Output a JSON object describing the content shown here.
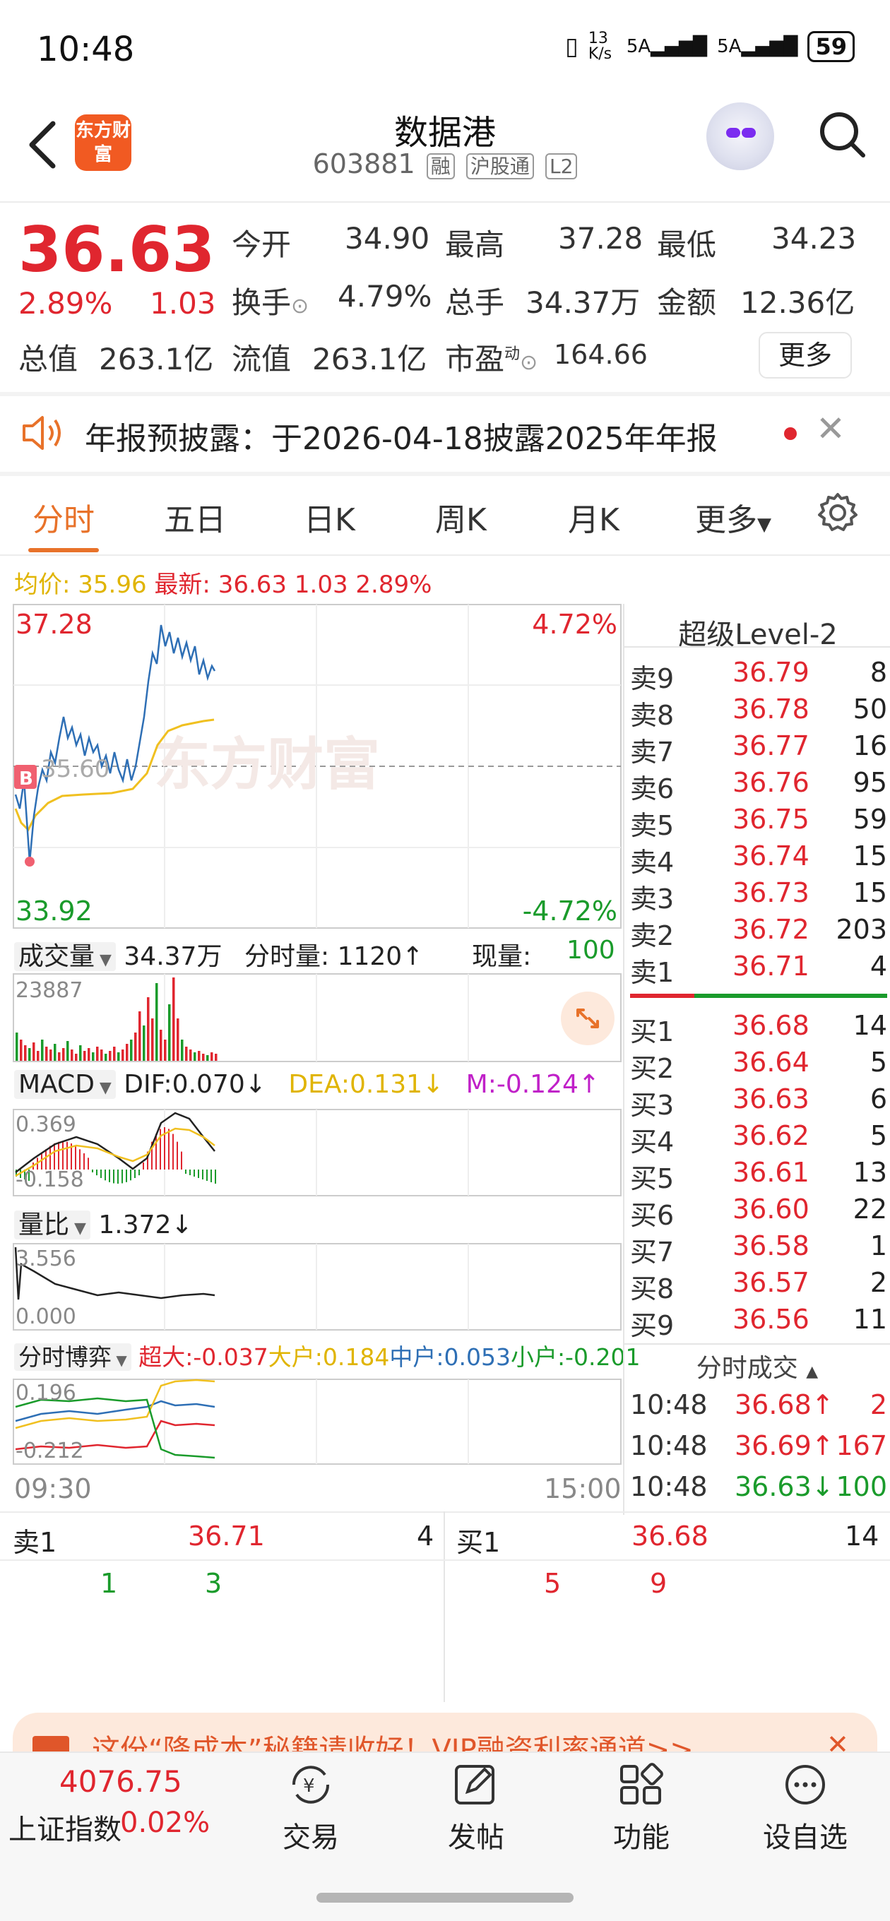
{
  "status_bar": {
    "time": "10:48",
    "net_speed": "13 K/s",
    "signal1": "5A",
    "signal2": "5A",
    "battery": "59"
  },
  "header": {
    "title": "数据港",
    "code": "603881",
    "tags": [
      "融",
      "沪股通",
      "L2"
    ],
    "logo_text": "东方财富"
  },
  "quote": {
    "price": "36.63",
    "pct": "2.89%",
    "change": "1.03",
    "open_label": "今开",
    "open": "34.90",
    "high_label": "最高",
    "high": "37.28",
    "low_label": "最低",
    "low": "34.23",
    "turnover_label": "换手",
    "turnover": "4.79%",
    "volume_label": "总手",
    "volume": "34.37万",
    "amount_label": "金额",
    "amount": "12.36亿",
    "mktcap_label": "总值",
    "mktcap": "263.1亿",
    "float_label": "流值",
    "float": "263.1亿",
    "pe_label": "市盈",
    "pe_sup": "动",
    "pe": "164.66",
    "more": "更多"
  },
  "notice": {
    "text": "年报预披露：于2026-04-18披露2025年年报"
  },
  "tabs": [
    "分时",
    "五日",
    "日K",
    "周K",
    "月K",
    "更多"
  ],
  "chart_info": {
    "avg_label": "均价:",
    "avg": "35.96",
    "latest_label": "最新:",
    "latest": "36.63",
    "chg": "1.03",
    "pct": "2.89%"
  },
  "main_chart": {
    "top_price": "37.28",
    "bottom_price": "33.92",
    "top_pct": "4.72%",
    "bottom_pct": "-4.72%",
    "mid": "35.60",
    "watermark": "东方财富",
    "b_marker": "B"
  },
  "volume": {
    "label": "成交量",
    "total": "34.37万",
    "fen_label": "分时量:",
    "fen": "1120↑",
    "now_label": "现量:",
    "now": "100",
    "max": "23887"
  },
  "macd": {
    "label": "MACD",
    "dif": "DIF:0.070↓",
    "dea": "DEA:0.131↓",
    "m": "M:-0.124↑",
    "top": "0.369",
    "bottom": "-0.158"
  },
  "ratio": {
    "label": "量比",
    "value": "1.372↓",
    "top": "3.556",
    "bottom": "0.000"
  },
  "game": {
    "label": "分时博弈",
    "big": "超大:-0.037",
    "large": "大户:0.184",
    "mid": "中户:0.053",
    "small": "小户:-0.201",
    "top": "0.196",
    "bottom": "-0.212"
  },
  "time_axis": {
    "start": "09:30",
    "end": "15:00"
  },
  "level2": {
    "title": "超级Level-2",
    "asks": [
      {
        "label": "卖9",
        "price": "36.79",
        "vol": "8"
      },
      {
        "label": "卖8",
        "price": "36.78",
        "vol": "50"
      },
      {
        "label": "卖7",
        "price": "36.77",
        "vol": "16"
      },
      {
        "label": "卖6",
        "price": "36.76",
        "vol": "95"
      },
      {
        "label": "卖5",
        "price": "36.75",
        "vol": "59"
      },
      {
        "label": "卖4",
        "price": "36.74",
        "vol": "15"
      },
      {
        "label": "卖3",
        "price": "36.73",
        "vol": "15"
      },
      {
        "label": "卖2",
        "price": "36.72",
        "vol": "203"
      },
      {
        "label": "卖1",
        "price": "36.71",
        "vol": "4"
      }
    ],
    "bids": [
      {
        "label": "买1",
        "price": "36.68",
        "vol": "14"
      },
      {
        "label": "买2",
        "price": "36.64",
        "vol": "5"
      },
      {
        "label": "买3",
        "price": "36.63",
        "vol": "6"
      },
      {
        "label": "买4",
        "price": "36.62",
        "vol": "5"
      },
      {
        "label": "买5",
        "price": "36.61",
        "vol": "13"
      },
      {
        "label": "买6",
        "price": "36.60",
        "vol": "22"
      },
      {
        "label": "买7",
        "price": "36.58",
        "vol": "1"
      },
      {
        "label": "买8",
        "price": "36.57",
        "vol": "2"
      },
      {
        "label": "买9",
        "price": "36.56",
        "vol": "11"
      }
    ],
    "ticks_label": "分时成交",
    "ticks": [
      {
        "time": "10:48",
        "price": "36.68↑",
        "vol": "2",
        "color": "#e0262f"
      },
      {
        "time": "10:48",
        "price": "36.69↑",
        "vol": "167",
        "color": "#e0262f"
      },
      {
        "time": "10:48",
        "price": "36.63↓",
        "vol": "100",
        "color": "#1a9b2b"
      }
    ]
  },
  "order_queue": {
    "sell_label": "卖1",
    "sell_price": "36.71",
    "sell_vol": "4",
    "sell_nums": [
      "1",
      "3"
    ],
    "buy_label": "买1",
    "buy_price": "36.68",
    "buy_vol": "14",
    "buy_nums": [
      "5",
      "9"
    ]
  },
  "ad": {
    "text": "这份“降成本”秘籍请收好！VIP融资利率通道>>"
  },
  "bottom": {
    "index_value": "4076.75",
    "index_name": "上证指数",
    "index_pct": "0.02%",
    "nav": [
      "交易",
      "发帖",
      "功能",
      "设自选"
    ]
  }
}
